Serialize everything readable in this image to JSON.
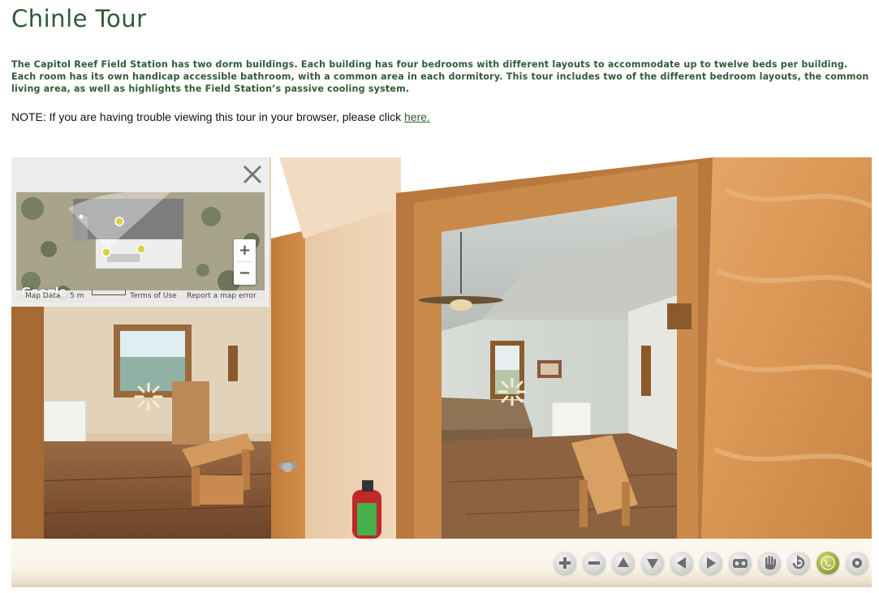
{
  "page": {
    "title": "Chinle Tour",
    "intro": "The Capitol Reef Field Station has two dorm buildings. Each building has four bedrooms with different layouts to accommodate up to twelve beds per building. Each room has its own handicap accessible bathroom, with a common area in each dormitory. This tour includes two of the different bedroom layouts, the common living area, as well as highlights the Field Station’s passive cooling system.",
    "note_text": "NOTE: If you are having trouble viewing this tour in your browser, please click ",
    "note_link": "here."
  },
  "map": {
    "google_logo": "Google",
    "footer": {
      "map_data": "Map Data",
      "scale": "5 m",
      "terms": "Terms of Use",
      "report": "Report a map error"
    },
    "zoom_in": "+",
    "zoom_out": "−",
    "close_icon": "close-icon"
  },
  "toolbar": {
    "buttons": [
      {
        "name": "zoom-in",
        "icon": "plus-icon"
      },
      {
        "name": "zoom-out",
        "icon": "minus-icon"
      },
      {
        "name": "look-up",
        "icon": "triangle-up-icon"
      },
      {
        "name": "look-down",
        "icon": "triangle-down-icon"
      },
      {
        "name": "look-left",
        "icon": "triangle-left-icon"
      },
      {
        "name": "look-right",
        "icon": "triangle-right-icon"
      },
      {
        "name": "vr-mode",
        "icon": "vr-goggles-icon"
      },
      {
        "name": "drag-mode",
        "icon": "hand-icon"
      },
      {
        "name": "autorotate",
        "icon": "rotate-icon"
      },
      {
        "name": "map-toggle",
        "icon": "globe-icon"
      },
      {
        "name": "fullscreen",
        "icon": "circle-dot-icon"
      }
    ]
  },
  "hotspots": [
    {
      "name": "hotspot-left-room",
      "icon": "sparkle-icon"
    },
    {
      "name": "hotspot-right-room",
      "icon": "sparkle-icon"
    }
  ],
  "colors": {
    "title_green": "#2f5a36",
    "link_green": "#2f5a36",
    "globe_green": "#98a83a"
  }
}
